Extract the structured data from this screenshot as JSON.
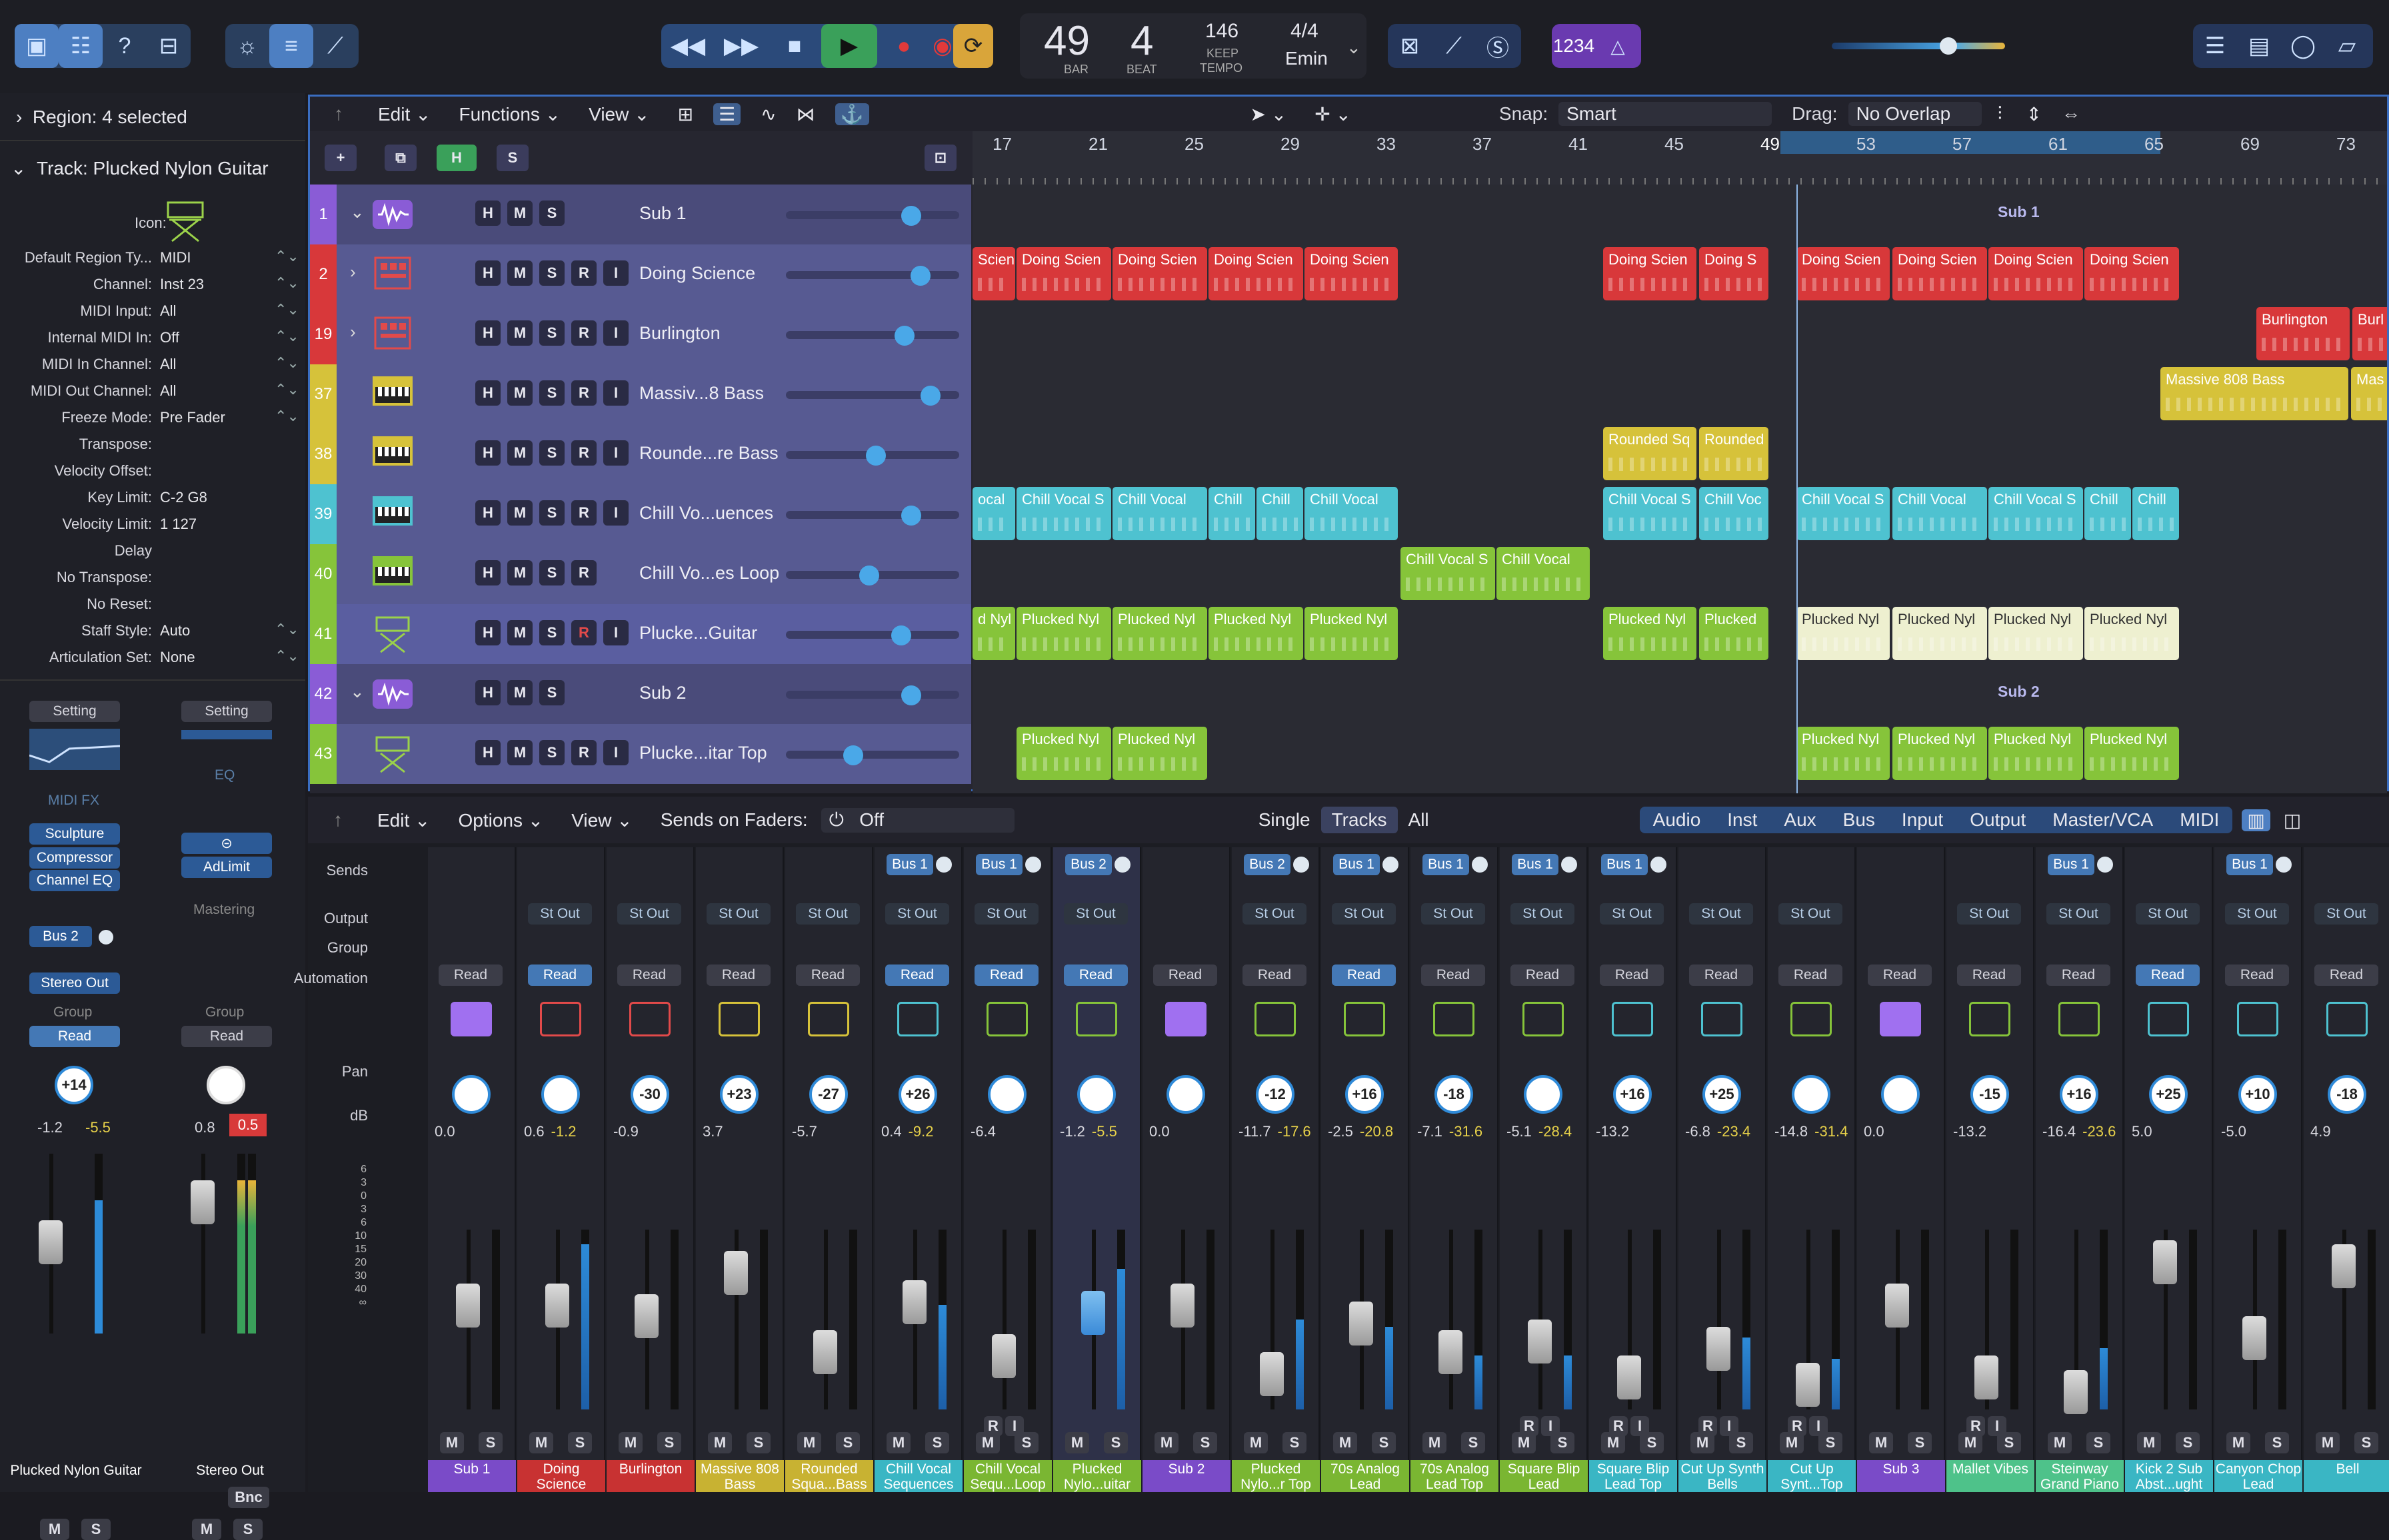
{
  "control_bar": {
    "lcd": {
      "bar": "49",
      "beat": "4",
      "bar_label": "BAR",
      "beat_label": "BEAT",
      "tempo": "146",
      "tempo_mode": "KEEP",
      "tempo_label": "TEMPO",
      "signature": "4/4",
      "key": "Emin"
    },
    "count_in": "1234",
    "icons": [
      "library-icon",
      "inspector-icon",
      "help-icon",
      "toolbar-icon",
      "smart-controls-icon",
      "mixer-icon",
      "editors-icon",
      "rewind-icon",
      "fast-forward-icon",
      "stop-icon",
      "play-icon",
      "record-icon",
      "capture-record-icon",
      "cycle-icon",
      "tuner-icon",
      "pencil-icon",
      "solo-icon",
      "list-icon",
      "notepad-icon",
      "loop-browser-icon",
      "browser-icon"
    ]
  },
  "inspector": {
    "region_header": "Region: 4 selected",
    "track_header": "Track: Plucked Nylon Guitar",
    "icon_label": "Icon:",
    "rows": [
      {
        "k": "Default Region Ty...",
        "v": "MIDI"
      },
      {
        "k": "Channel:",
        "v": "Inst 23"
      },
      {
        "k": "MIDI Input:",
        "v": "All"
      },
      {
        "k": "Internal MIDI In:",
        "v": "Off"
      },
      {
        "k": "MIDI In Channel:",
        "v": "All"
      },
      {
        "k": "MIDI Out Channel:",
        "v": "All"
      },
      {
        "k": "Freeze Mode:",
        "v": "Pre Fader"
      },
      {
        "k": "Transpose:",
        "v": ""
      },
      {
        "k": "Velocity Offset:",
        "v": ""
      },
      {
        "k": "Key Limit:",
        "v": "C-2  G8"
      },
      {
        "k": "Velocity Limit:",
        "v": "1  127"
      },
      {
        "k": "Delay",
        "v": ""
      },
      {
        "k": "No Transpose:",
        "v": ""
      },
      {
        "k": "No Reset:",
        "v": ""
      },
      {
        "k": "Staff Style:",
        "v": "Auto"
      },
      {
        "k": "Articulation Set:",
        "v": "None"
      }
    ],
    "strip1": {
      "setting": "Setting",
      "midifx": "MIDI FX",
      "plugins": [
        "Sculpture",
        "Compressor",
        "Channel EQ"
      ],
      "bus": "Bus 2",
      "output": "Stereo Out",
      "group": "Group",
      "read": "Read",
      "pan": "+14",
      "db": "-1.2",
      "peak": "-5.5",
      "m": "M",
      "s": "S",
      "name": "Plucked Nylon Guitar"
    },
    "strip2": {
      "setting": "Setting",
      "eq": "EQ",
      "plugin": "AdLimit",
      "mastering": "Mastering",
      "group": "Group",
      "read": "Read",
      "db": "0.8",
      "peak": "0.5",
      "bnc": "Bnc",
      "m": "M",
      "s": "S",
      "name": "Stereo Out"
    }
  },
  "tracks_menu": {
    "edit": "Edit",
    "functions": "Functions",
    "view": "View",
    "snap_label": "Snap:",
    "snap": "Smart",
    "drag_label": "Drag:",
    "drag": "No Overlap"
  },
  "track_header_buttons": {
    "add": "+",
    "h": "H",
    "s": "S"
  },
  "ruler": [
    "17",
    "21",
    "25",
    "29",
    "33",
    "37",
    "41",
    "45",
    "49",
    "53",
    "57",
    "61",
    "65",
    "69",
    "73"
  ],
  "tracks": [
    {
      "num": "1",
      "name": "Sub 1",
      "color": "#8a5cd6",
      "btns": [
        "H",
        "M",
        "S"
      ],
      "vol": 0.72,
      "folder": true
    },
    {
      "num": "2",
      "name": "Doing Science",
      "color": "#d8383a",
      "btns": [
        "H",
        "M",
        "S",
        "R",
        "I"
      ],
      "vol": 0.78
    },
    {
      "num": "19",
      "name": "Burlington",
      "color": "#d8383a",
      "btns": [
        "H",
        "M",
        "S",
        "R",
        "I"
      ],
      "vol": 0.68
    },
    {
      "num": "37",
      "name": "Massiv...8 Bass",
      "color": "#d6c23a",
      "btns": [
        "H",
        "M",
        "S",
        "R",
        "I"
      ],
      "vol": 0.84
    },
    {
      "num": "38",
      "name": "Rounde...re Bass",
      "color": "#d6c23a",
      "btns": [
        "H",
        "M",
        "S",
        "R",
        "I"
      ],
      "vol": 0.5
    },
    {
      "num": "39",
      "name": "Chill Vo...uences",
      "color": "#4ec2d0",
      "btns": [
        "H",
        "M",
        "S",
        "R",
        "I"
      ],
      "vol": 0.72
    },
    {
      "num": "40",
      "name": "Chill Vo...es Loop",
      "color": "#86c43a",
      "btns": [
        "H",
        "M",
        "S",
        "R"
      ],
      "vol": 0.46
    },
    {
      "num": "41",
      "name": "Plucke...Guitar",
      "color": "#86c43a",
      "btns": [
        "H",
        "M",
        "S",
        "R",
        "I"
      ],
      "vol": 0.66
    },
    {
      "num": "42",
      "name": "Sub 2",
      "color": "#8a5cd6",
      "btns": [
        "H",
        "M",
        "S"
      ],
      "vol": 0.72,
      "folder": true
    },
    {
      "num": "43",
      "name": "Plucke...itar Top",
      "color": "#86c43a",
      "btns": [
        "H",
        "M",
        "S",
        "R",
        "I"
      ],
      "vol": 0.36
    }
  ],
  "region_labels": {
    "sub1": "Sub 1",
    "sub2": "Sub 2",
    "ds": "Doing Scien",
    "ds2": "Doing S",
    "bur": "Burlington",
    "bur2": "Burl",
    "mb": "Massive 808 Bass",
    "mb2": "Mas",
    "rs": "Rounded Sq",
    "rs2": "Rounded",
    "cv": "Chill Vocal",
    "cvs": "Chill Vocal S",
    "cvc": "Chill Voc",
    "cvl": "Chill",
    "ocal": "ocal",
    "cvsr": "Chill Vocal S",
    "pn": "Plucked Nyl",
    "pn2": "Plucked",
    "dnyl": "d Nyl",
    "scien": "Scien"
  },
  "mixer_menu": {
    "edit": "Edit",
    "options": "Options",
    "view": "View",
    "sends_on_faders": "Sends on Faders:",
    "off": "Off",
    "single": "Single",
    "tracks": "Tracks",
    "all": "All",
    "filters": [
      "Audio",
      "Inst",
      "Aux",
      "Bus",
      "Input",
      "Output",
      "Master/VCA",
      "MIDI"
    ]
  },
  "mixer_rows": {
    "sends": "Sends",
    "output": "Output",
    "group": "Group",
    "automation": "Automation",
    "pan": "Pan",
    "db": "dB"
  },
  "strips": [
    {
      "name": "Sub 1",
      "color": "#7a4bc8",
      "send": "",
      "out": "",
      "read": "Read",
      "pan": "",
      "db": "0.0",
      "pk": "",
      "fader": 0.7,
      "lvl": 0,
      "icon": "purple"
    },
    {
      "name": "Doing Science",
      "color": "#c83232",
      "send": "",
      "out": "St Out",
      "read": "Read",
      "readon": true,
      "pan": "",
      "db": "0.6",
      "pk": "-1.2",
      "fader": 0.7,
      "lvl": 0.92,
      "icon": "red"
    },
    {
      "name": "Burlington",
      "color": "#c83232",
      "send": "",
      "out": "St Out",
      "read": "Read",
      "pan": "-30",
      "db": "-0.9",
      "pk": "",
      "fader": 0.64,
      "lvl": 0,
      "icon": "red"
    },
    {
      "name": "Massive 808 Bass",
      "color": "#c8b232",
      "send": "",
      "out": "St Out",
      "read": "Read",
      "pan": "+23",
      "db": "3.7",
      "pk": "",
      "fader": 0.88,
      "lvl": 0,
      "icon": "yellow"
    },
    {
      "name": "Rounded Squa...Bass",
      "color": "#c8b232",
      "send": "",
      "out": "St Out",
      "read": "Read",
      "pan": "-27",
      "db": "-5.7",
      "pk": "",
      "fader": 0.44,
      "lvl": 0,
      "icon": "yellow"
    },
    {
      "name": "Chill Vocal Sequences",
      "color": "#3ab6c4",
      "send": "Bus 1",
      "out": "St Out",
      "read": "Read",
      "readon": true,
      "pan": "+26",
      "db": "0.4",
      "pk": "-9.2",
      "fader": 0.72,
      "lvl": 0.58,
      "icon": "cyan"
    },
    {
      "name": "Chill Vocal Sequ...Loop",
      "color": "#7ab632",
      "send": "Bus 1",
      "out": "St Out",
      "read": "Read",
      "readon": true,
      "pan": "",
      "db": "-6.4",
      "pk": "",
      "fader": 0.42,
      "lvl": 0,
      "icon": "green",
      "ri": true
    },
    {
      "name": "Plucked Nylo...uitar",
      "color": "#7ab632",
      "send": "Bus 2",
      "out": "St Out",
      "read": "Read",
      "readon": true,
      "pan": "",
      "db": "-1.2",
      "pk": "-5.5",
      "fader": 0.66,
      "lvl": 0.78,
      "icon": "green",
      "sel": true
    },
    {
      "name": "Sub 2",
      "color": "#7a4bc8",
      "send": "",
      "out": "",
      "read": "Read",
      "pan": "",
      "db": "0.0",
      "pk": "",
      "fader": 0.7,
      "lvl": 0,
      "icon": "purple"
    },
    {
      "name": "Plucked Nylo...r Top",
      "color": "#7ab632",
      "send": "Bus 2",
      "out": "St Out",
      "read": "Read",
      "pan": "-12",
      "db": "-11.7",
      "pk": "-17.6",
      "fader": 0.32,
      "lvl": 0.5,
      "icon": "green"
    },
    {
      "name": "70s Analog Lead",
      "color": "#7ab632",
      "send": "Bus 1",
      "out": "St Out",
      "read": "Read",
      "readon": true,
      "pan": "+16",
      "db": "-2.5",
      "pk": "-20.8",
      "fader": 0.6,
      "lvl": 0.46,
      "icon": "green"
    },
    {
      "name": "70s Analog Lead Top",
      "color": "#7ab632",
      "send": "Bus 1",
      "out": "St Out",
      "read": "Read",
      "pan": "-18",
      "db": "-7.1",
      "pk": "-31.6",
      "fader": 0.44,
      "lvl": 0.3,
      "icon": "green"
    },
    {
      "name": "Square Blip Lead",
      "color": "#7ab632",
      "send": "Bus 1",
      "out": "St Out",
      "read": "Read",
      "pan": "",
      "db": "-5.1",
      "pk": "-28.4",
      "fader": 0.5,
      "lvl": 0.3,
      "icon": "green",
      "ri": true
    },
    {
      "name": "Square Blip Lead Top",
      "color": "#3ab6c4",
      "send": "Bus 1",
      "out": "St Out",
      "read": "Read",
      "pan": "+16",
      "db": "-13.2",
      "pk": "",
      "fader": 0.3,
      "lvl": 0,
      "icon": "cyan",
      "ri": true
    },
    {
      "name": "Cut Up Synth Bells",
      "color": "#3ab6c4",
      "send": "",
      "out": "St Out",
      "read": "Read",
      "pan": "+25",
      "db": "-6.8",
      "pk": "-23.4",
      "fader": 0.46,
      "lvl": 0.4,
      "icon": "cyan",
      "ri": true
    },
    {
      "name": "Cut Up Synt...Top",
      "color": "#3ab6c4",
      "send": "",
      "out": "St Out",
      "read": "Read",
      "pan": "",
      "db": "-14.8",
      "pk": "-31.4",
      "fader": 0.26,
      "lvl": 0.28,
      "icon": "green",
      "ri": true
    },
    {
      "name": "Sub 3",
      "color": "#7a4bc8",
      "send": "",
      "out": "",
      "read": "Read",
      "pan": "",
      "db": "0.0",
      "pk": "",
      "fader": 0.7,
      "lvl": 0,
      "icon": "purple"
    },
    {
      "name": "Mallet Vibes",
      "color": "#4ec28a",
      "send": "",
      "out": "St Out",
      "read": "Read",
      "pan": "-15",
      "db": "-13.2",
      "pk": "",
      "fader": 0.3,
      "lvl": 0,
      "icon": "green",
      "ri": true
    },
    {
      "name": "Steinway Grand Piano",
      "color": "#4ec28a",
      "send": "Bus 1",
      "out": "St Out",
      "read": "Read",
      "pan": "+16",
      "db": "-16.4",
      "pk": "-23.6",
      "fader": 0.22,
      "lvl": 0.34,
      "icon": "green"
    },
    {
      "name": "Kick 2 Sub Abst...ught",
      "color": "#3ab6c4",
      "send": "",
      "out": "St Out",
      "read": "Read",
      "readon": true,
      "pan": "+25",
      "db": "5.0",
      "pk": "",
      "fader": 0.94,
      "lvl": 0,
      "icon": "cyan"
    },
    {
      "name": "Canyon Chop Lead",
      "color": "#3ab6c4",
      "send": "Bus 1",
      "out": "St Out",
      "read": "Read",
      "pan": "+10",
      "db": "-5.0",
      "pk": "",
      "fader": 0.52,
      "lvl": 0,
      "icon": "cyan"
    },
    {
      "name": "Bell",
      "color": "#3ab6c4",
      "send": "",
      "out": "St Out",
      "read": "Read",
      "pan": "-18",
      "db": "4.9",
      "pk": "",
      "fader": 0.92,
      "lvl": 0,
      "icon": "cyan"
    }
  ]
}
